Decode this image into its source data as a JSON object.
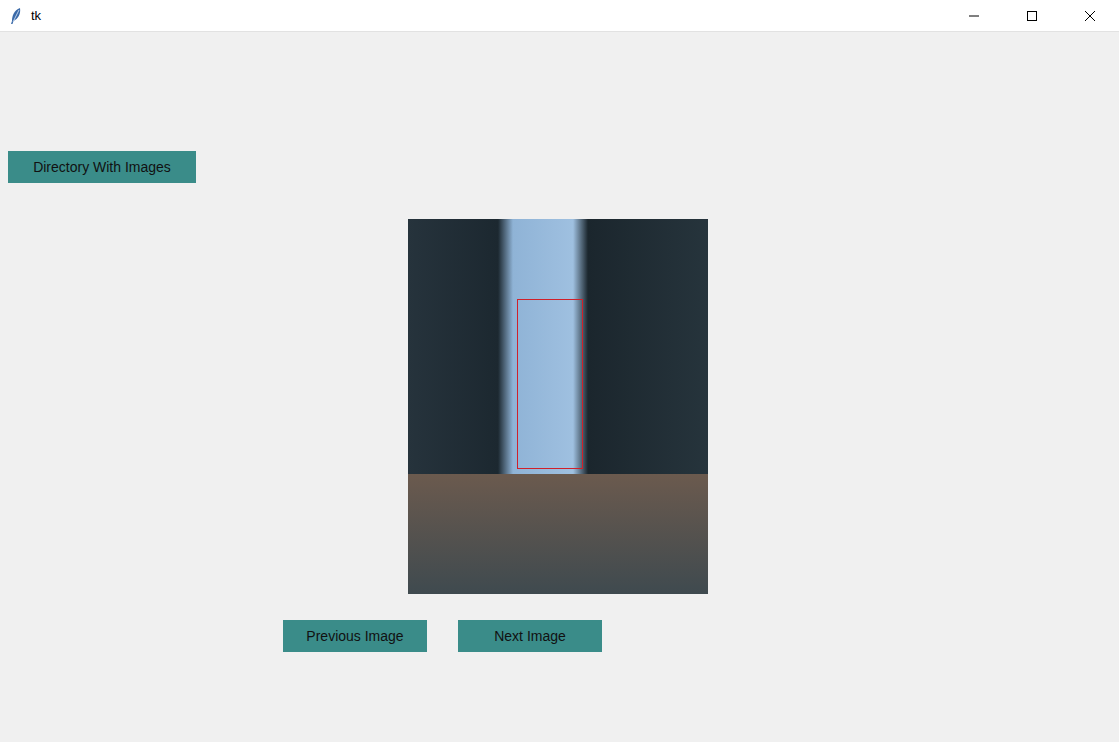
{
  "window": {
    "title": "tk"
  },
  "directory_button": "Directory With Images",
  "nav_buttons": [
    "Previous Image",
    "Next Image"
  ]
}
